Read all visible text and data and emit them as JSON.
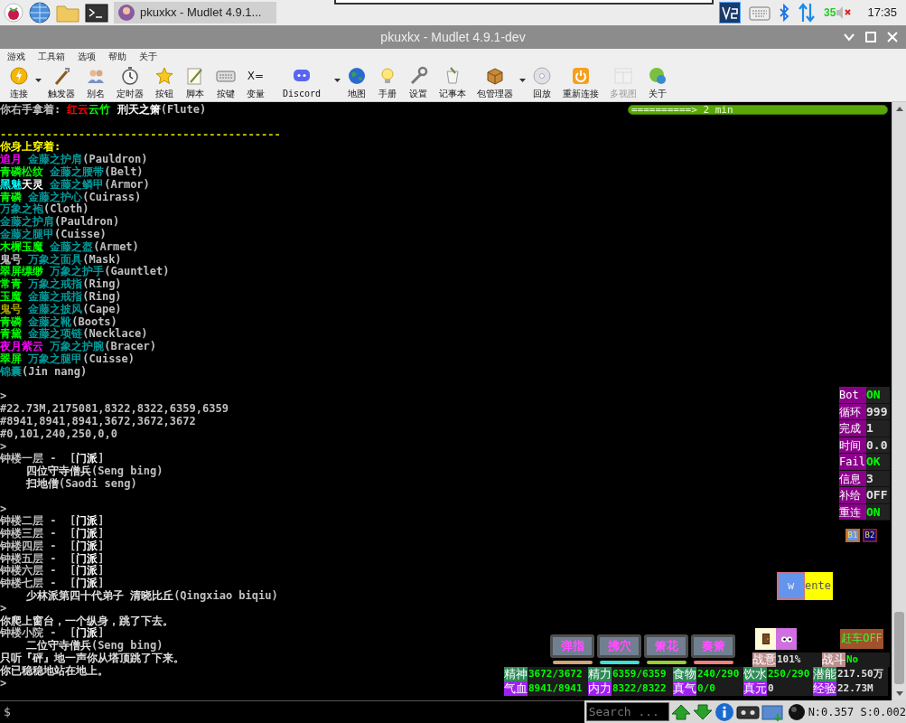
{
  "taskbar": {
    "task_button": {
      "label": "pkuxkx - Mudlet 4.9.1..."
    },
    "tray": {
      "indicator": "35",
      "clock": "17:35"
    }
  },
  "window": {
    "title": "pkuxkx - Mudlet 4.9.1-dev"
  },
  "menu": [
    "游戏",
    "工具箱",
    "选项",
    "帮助",
    "关于"
  ],
  "toolbar": [
    {
      "label": "连接",
      "dropdown": true,
      "disabled": false
    },
    {
      "label": "触发器",
      "dropdown": false,
      "disabled": false
    },
    {
      "label": "别名",
      "dropdown": false,
      "disabled": false
    },
    {
      "label": "定时器",
      "dropdown": false,
      "disabled": false
    },
    {
      "label": "按钮",
      "dropdown": false,
      "disabled": false
    },
    {
      "label": "脚本",
      "dropdown": false,
      "disabled": false
    },
    {
      "label": "按键",
      "dropdown": false,
      "disabled": false
    },
    {
      "label": "变量",
      "glyph": "X=",
      "dropdown": false,
      "disabled": false
    },
    {
      "label": "Discord",
      "dropdown": true,
      "disabled": false
    },
    {
      "label": "地图",
      "dropdown": false,
      "disabled": false
    },
    {
      "label": "手册",
      "dropdown": false,
      "disabled": false
    },
    {
      "label": "设置",
      "dropdown": false,
      "disabled": false
    },
    {
      "label": "记事本",
      "dropdown": false,
      "disabled": false
    },
    {
      "label": "包管理器",
      "dropdown": true,
      "disabled": false
    },
    {
      "label": "回放",
      "dropdown": false,
      "disabled": false
    },
    {
      "label": "重新连接",
      "dropdown": false,
      "disabled": false
    },
    {
      "label": "多视图",
      "dropdown": false,
      "disabled": true
    },
    {
      "label": "关于",
      "dropdown": false,
      "disabled": false
    }
  ],
  "console": {
    "timer_bar": {
      "text": "==========> 2 min"
    },
    "lines": [
      {
        "kind": "text",
        "segments": [
          {
            "text": "你右手拿着: ",
            "color": "#c0c0c0"
          },
          {
            "text": "红云",
            "color": "#ff0000"
          },
          {
            "text": "云竹",
            "color": "#00ff00"
          },
          {
            "text": " 刑天之箫",
            "color": "#ffffff"
          },
          {
            "text": "(Flute)",
            "color": "#c0c0c0"
          }
        ]
      },
      {
        "kind": "blank"
      },
      {
        "kind": "text",
        "segments": [
          {
            "text": "-------------------------------------------",
            "color": "#c8c800"
          }
        ]
      },
      {
        "kind": "text",
        "segments": [
          {
            "text": "你身上穿着:",
            "color": "#ffff00"
          }
        ]
      },
      {
        "kind": "text",
        "segments": [
          {
            "text": "追月",
            "color": "#ff00ff"
          },
          {
            "text": " 金藤之护肩",
            "color": "#009a9a"
          },
          {
            "text": "(Pauldron)",
            "color": "#c0c0c0"
          }
        ]
      },
      {
        "kind": "text",
        "segments": [
          {
            "text": "青磷松纹",
            "color": "#00ff00"
          },
          {
            "text": " 金藤之腰带",
            "color": "#009a9a"
          },
          {
            "text": "(Belt)",
            "color": "#c0c0c0"
          }
        ]
      },
      {
        "kind": "text",
        "segments": [
          {
            "text": "黑魅",
            "color": "#00ffff"
          },
          {
            "text": "天灵",
            "color": "#ffffff"
          },
          {
            "text": " 金藤之鳞甲",
            "color": "#009a9a"
          },
          {
            "text": "(Armor)",
            "color": "#c0c0c0"
          }
        ]
      },
      {
        "kind": "text",
        "segments": [
          {
            "text": "青磷",
            "color": "#00ff00"
          },
          {
            "text": " 金藤之护心",
            "color": "#009a9a"
          },
          {
            "text": "(Cuirass)",
            "color": "#c0c0c0"
          }
        ]
      },
      {
        "kind": "text",
        "segments": [
          {
            "text": "万象之袍",
            "color": "#009a9a"
          },
          {
            "text": "(Cloth)",
            "color": "#c0c0c0"
          }
        ]
      },
      {
        "kind": "text",
        "segments": [
          {
            "text": "金藤之护肩",
            "color": "#009a9a"
          },
          {
            "text": "(Pauldron)",
            "color": "#c0c0c0"
          }
        ]
      },
      {
        "kind": "text",
        "segments": [
          {
            "text": "金藤之腿甲",
            "color": "#009a9a"
          },
          {
            "text": "(Cuisse)",
            "color": "#c0c0c0"
          }
        ]
      },
      {
        "kind": "text",
        "segments": [
          {
            "text": "木樨玉魔",
            "color": "#00ff00"
          },
          {
            "text": " 金藤之盔",
            "color": "#009a9a"
          },
          {
            "text": "(Armet)",
            "color": "#c0c0c0"
          }
        ]
      },
      {
        "kind": "text",
        "segments": [
          {
            "text": "鬼号",
            "color": "#c0c0c0"
          },
          {
            "text": " 万象之面具",
            "color": "#009a9a"
          },
          {
            "text": "(Mask)",
            "color": "#c0c0c0"
          }
        ]
      },
      {
        "kind": "text",
        "segments": [
          {
            "text": "翠屏缥缈",
            "color": "#00ff00"
          },
          {
            "text": " 万象之护手",
            "color": "#009a9a"
          },
          {
            "text": "(Gauntlet)",
            "color": "#c0c0c0"
          }
        ]
      },
      {
        "kind": "text",
        "segments": [
          {
            "text": "常青",
            "color": "#00ff00"
          },
          {
            "text": " 万象之戒指",
            "color": "#009a9a"
          },
          {
            "text": "(Ring)",
            "color": "#c0c0c0"
          }
        ]
      },
      {
        "kind": "text",
        "segments": [
          {
            "text": "玉魔",
            "color": "#00ff00"
          },
          {
            "text": " 金藤之戒指",
            "color": "#009a9a"
          },
          {
            "text": "(Ring)",
            "color": "#c0c0c0"
          }
        ]
      },
      {
        "kind": "text",
        "segments": [
          {
            "text": "鬼号",
            "color": "#a8a800"
          },
          {
            "text": " 金藤之披风",
            "color": "#009a9a"
          },
          {
            "text": "(Cape)",
            "color": "#c0c0c0"
          }
        ]
      },
      {
        "kind": "text",
        "segments": [
          {
            "text": "青磷",
            "color": "#00ff00"
          },
          {
            "text": " 金藤之靴",
            "color": "#009a9a"
          },
          {
            "text": "(Boots)",
            "color": "#c0c0c0"
          }
        ]
      },
      {
        "kind": "text",
        "segments": [
          {
            "text": "青黛",
            "color": "#00ff00"
          },
          {
            "text": " 金藤之项链",
            "color": "#009a9a"
          },
          {
            "text": "(Necklace)",
            "color": "#c0c0c0"
          }
        ]
      },
      {
        "kind": "text",
        "segments": [
          {
            "text": "夜月紫云",
            "color": "#ff00ff"
          },
          {
            "text": " 万象之护腕",
            "color": "#009a9a"
          },
          {
            "text": "(Bracer)",
            "color": "#c0c0c0"
          }
        ]
      },
      {
        "kind": "text",
        "segments": [
          {
            "text": "翠屏",
            "color": "#00ff00"
          },
          {
            "text": " 万象之腿甲",
            "color": "#009a9a"
          },
          {
            "text": "(Cuisse)",
            "color": "#c0c0c0"
          }
        ]
      },
      {
        "kind": "text",
        "segments": [
          {
            "text": "锦囊",
            "color": "#009a9a"
          },
          {
            "text": "(Jin nang)",
            "color": "#c0c0c0"
          }
        ]
      },
      {
        "kind": "blank"
      },
      {
        "kind": "text",
        "segments": [
          {
            "text": ">",
            "color": "#c0c0c0"
          }
        ]
      },
      {
        "kind": "text",
        "segments": [
          {
            "text": "#22.73M,2175081,8322,8322,6359,6359",
            "color": "#c0c0c0"
          }
        ]
      },
      {
        "kind": "text",
        "segments": [
          {
            "text": "#8941,8941,8941,3672,3672,3672",
            "color": "#c0c0c0"
          }
        ]
      },
      {
        "kind": "text",
        "segments": [
          {
            "text": "#0,101,240,250,0,0",
            "color": "#c0c0c0"
          }
        ]
      },
      {
        "kind": "text",
        "segments": [
          {
            "text": ">",
            "color": "#c0c0c0"
          }
        ]
      },
      {
        "kind": "text",
        "segments": [
          {
            "text": "钟楼一层 -  [",
            "color": "#c0c0c0"
          },
          {
            "text": "门派",
            "color": "#ffffff"
          },
          {
            "text": "]",
            "color": "#c0c0c0"
          }
        ]
      },
      {
        "kind": "text",
        "segments": [
          {
            "text": "    四位守寺僧兵",
            "color": "#e0e0e0"
          },
          {
            "text": "(Seng bing)",
            "color": "#c0c0c0"
          }
        ]
      },
      {
        "kind": "text",
        "segments": [
          {
            "text": "    扫地僧",
            "color": "#e0e0e0"
          },
          {
            "text": "(Saodi seng)",
            "color": "#c0c0c0"
          }
        ]
      },
      {
        "kind": "blank"
      },
      {
        "kind": "text",
        "segments": [
          {
            "text": ">",
            "color": "#c0c0c0"
          }
        ]
      },
      {
        "kind": "text",
        "segments": [
          {
            "text": "钟楼二层 -  [",
            "color": "#c0c0c0"
          },
          {
            "text": "门派",
            "color": "#ffffff"
          },
          {
            "text": "]",
            "color": "#c0c0c0"
          }
        ]
      },
      {
        "kind": "text",
        "segments": [
          {
            "text": "钟楼三层 -  [",
            "color": "#c0c0c0"
          },
          {
            "text": "门派",
            "color": "#ffffff"
          },
          {
            "text": "]",
            "color": "#c0c0c0"
          }
        ]
      },
      {
        "kind": "text",
        "segments": [
          {
            "text": "钟楼四层 -  [",
            "color": "#c0c0c0"
          },
          {
            "text": "门派",
            "color": "#ffffff"
          },
          {
            "text": "]",
            "color": "#c0c0c0"
          }
        ]
      },
      {
        "kind": "text",
        "segments": [
          {
            "text": "钟楼五层 -  [",
            "color": "#c0c0c0"
          },
          {
            "text": "门派",
            "color": "#ffffff"
          },
          {
            "text": "]",
            "color": "#c0c0c0"
          }
        ]
      },
      {
        "kind": "text",
        "segments": [
          {
            "text": "钟楼六层 -  [",
            "color": "#c0c0c0"
          },
          {
            "text": "门派",
            "color": "#ffffff"
          },
          {
            "text": "]",
            "color": "#c0c0c0"
          }
        ]
      },
      {
        "kind": "text",
        "segments": [
          {
            "text": "钟楼七层 -  [",
            "color": "#c0c0c0"
          },
          {
            "text": "门派",
            "color": "#ffffff"
          },
          {
            "text": "]",
            "color": "#c0c0c0"
          }
        ]
      },
      {
        "kind": "text",
        "segments": [
          {
            "text": "    少林派第四十代弟子 清晓比丘",
            "color": "#e0e0e0"
          },
          {
            "text": "(Qingxiao biqiu)",
            "color": "#c0c0c0"
          }
        ]
      },
      {
        "kind": "text",
        "segments": [
          {
            "text": ">",
            "color": "#c0c0c0"
          }
        ]
      },
      {
        "kind": "text",
        "segments": [
          {
            "text": "你爬上窗台，一个纵身，跳了下去。",
            "color": "#e0e0e0"
          }
        ]
      },
      {
        "kind": "text",
        "segments": [
          {
            "text": "钟楼小院 -  [",
            "color": "#c0c0c0"
          },
          {
            "text": "门派",
            "color": "#ffffff"
          },
          {
            "text": "]",
            "color": "#c0c0c0"
          }
        ]
      },
      {
        "kind": "text",
        "segments": [
          {
            "text": "    二位守寺僧兵",
            "color": "#e0e0e0"
          },
          {
            "text": "(Seng bing)",
            "color": "#c0c0c0"
          }
        ]
      },
      {
        "kind": "text",
        "segments": [
          {
            "text": "只听『砰』地一声你从塔顶跳了下来。",
            "color": "#e0e0e0"
          }
        ]
      },
      {
        "kind": "text",
        "segments": [
          {
            "text": "你已稳稳地站在地上。",
            "color": "#e0e0e0"
          }
        ]
      },
      {
        "kind": "text",
        "segments": [
          {
            "text": ">",
            "color": "#c0c0c0"
          }
        ]
      }
    ]
  },
  "bot_panel": [
    {
      "label": "Bot",
      "value": "ON",
      "color": "#00ff00"
    },
    {
      "label": "循环",
      "value": "999",
      "color": "#e0e0e0"
    },
    {
      "label": "完成",
      "value": "1",
      "color": "#e0e0e0"
    },
    {
      "label": "时间",
      "value": "0.0",
      "color": "#e0e0e0"
    },
    {
      "label": "Fail",
      "value": "OK",
      "color": "#00ff00"
    },
    {
      "label": "信息",
      "value": "3",
      "color": "#e0e0e0"
    },
    {
      "label": "补给",
      "value": "OFF",
      "color": "#e0e0e0"
    },
    {
      "label": "重连",
      "value": "ON",
      "color": "#00ff00"
    }
  ],
  "bot_buttons": [
    {
      "label": "B1",
      "color": "#6495ed"
    },
    {
      "label": "B2",
      "color": "#000080"
    }
  ],
  "key_buttons": [
    {
      "label": "w",
      "color": "#6495ed"
    },
    {
      "label": "ente",
      "color": "#ffff00"
    }
  ],
  "skills": [
    {
      "label": "弹指",
      "color": "#d2a679"
    },
    {
      "label": "拂穴",
      "color": "#40e0d0"
    },
    {
      "label": "箫花",
      "color": "#9acd32"
    },
    {
      "label": "奏箫",
      "color": "#f08080"
    }
  ],
  "cart_button": {
    "label": "赶车OFF"
  },
  "combat": [
    {
      "label": {
        "text": "战意",
        "color": "#bc8f8f"
      },
      "value": {
        "text": "101%",
        "color": "#e0e0e0"
      }
    },
    {
      "label": {
        "text": "战斗",
        "color": "#bc8f8f"
      },
      "value": {
        "text": "No",
        "color": "#00ff00"
      }
    }
  ],
  "stats": [
    [
      {
        "label": {
          "text": "精神",
          "color": "#2e8b57"
        },
        "value": {
          "text": "3672/3672",
          "color": "#00ff00"
        }
      },
      {
        "label": {
          "text": "精力",
          "color": "#2e8b57"
        },
        "value": {
          "text": "6359/6359",
          "color": "#00ff00"
        }
      },
      {
        "label": {
          "text": "食物",
          "color": "#2e8b57"
        },
        "value": {
          "text": "240/290",
          "color": "#00ff00"
        }
      },
      {
        "label": {
          "text": "饮水",
          "color": "#2e8b57"
        },
        "value": {
          "text": "250/290",
          "color": "#00ff00"
        }
      },
      {
        "label": {
          "text": "潜能",
          "color": "#2e8b57"
        },
        "value": {
          "text": "217.50万",
          "color": "#e0e0e0"
        }
      }
    ],
    [
      {
        "label": {
          "text": "气血",
          "color": "#a020f0"
        },
        "value": {
          "text": "8941/8941",
          "color": "#00ff00"
        }
      },
      {
        "label": {
          "text": "内力",
          "color": "#a020f0"
        },
        "value": {
          "text": "8322/8322",
          "color": "#00ff00"
        }
      },
      {
        "label": {
          "text": "真气",
          "color": "#a020f0"
        },
        "value": {
          "text": "0/0",
          "color": "#00ff00"
        }
      },
      {
        "label": {
          "text": "真元",
          "color": "#a020f0"
        },
        "value": {
          "text": "0",
          "color": "#e0e0e0"
        }
      },
      {
        "label": {
          "text": "经验",
          "color": "#a020f0"
        },
        "value": {
          "text": "22.73M",
          "color": "#e0e0e0"
        }
      }
    ]
  ],
  "command_line": {
    "prompt": "$"
  },
  "search": {
    "placeholder": "Search ..."
  },
  "status": "N:0.357 S:0.002"
}
